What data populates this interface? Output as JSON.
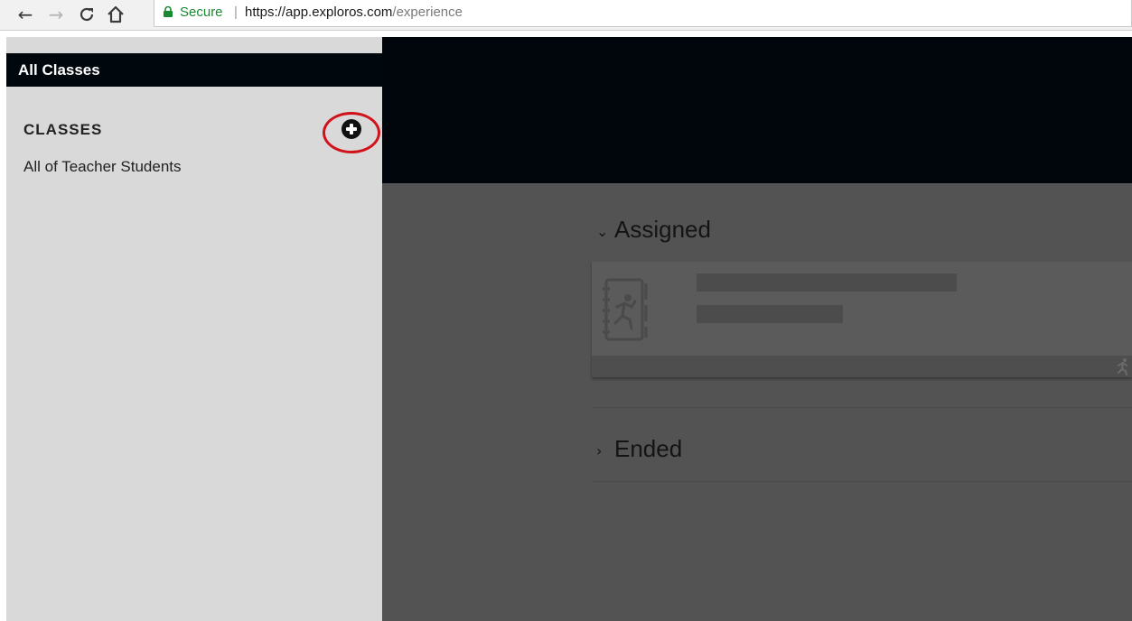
{
  "browser": {
    "secure_label": "Secure",
    "url_host": "https://app.exploros.com",
    "url_path": "/experience",
    "icons": [
      "back-arrow-icon",
      "forward-arrow-icon",
      "reload-icon",
      "home-icon",
      "lock-icon"
    ]
  },
  "sidebar": {
    "title": "All Classes",
    "classes_heading": "CLASSES",
    "items": [
      {
        "label": "All of Teacher Students"
      }
    ],
    "add_icon": "plus-circle-icon"
  },
  "main": {
    "sections": [
      {
        "label": "Assigned",
        "expanded": true
      },
      {
        "label": "Ended",
        "expanded": false
      }
    ]
  },
  "colors": {
    "header_bg": "#00060b",
    "sidebar_bg": "#d9d9d9",
    "overlay_bg": "#535353",
    "highlight_circle": "#d0121b",
    "secure_green": "#1a8a32"
  }
}
